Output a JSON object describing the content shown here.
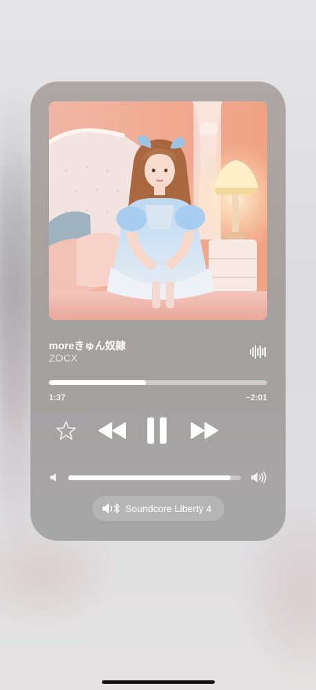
{
  "now_playing": {
    "title": "moreきゅん奴隷",
    "artist": "ZOCX",
    "artwork_icon": "album-artwork",
    "elapsed": "1:37",
    "remaining": "−2:01",
    "progress": 0.445
  },
  "controls": {
    "favorite_icon": "star-icon",
    "rewind_icon": "rewind-icon",
    "pause_icon": "pause-icon",
    "forward_icon": "fast-forward-icon"
  },
  "volume": {
    "level": 0.94,
    "low_icon": "speaker-low-icon",
    "high_icon": "speaker-high-icon"
  },
  "audio_output": {
    "icon": "bluetooth-speaker-icon",
    "device": "Soundcore Liberty 4"
  },
  "colors": {
    "panel": "#a8a3a1",
    "accent": "#ffffff",
    "track": "rgba(255,255,255,0.45)"
  }
}
